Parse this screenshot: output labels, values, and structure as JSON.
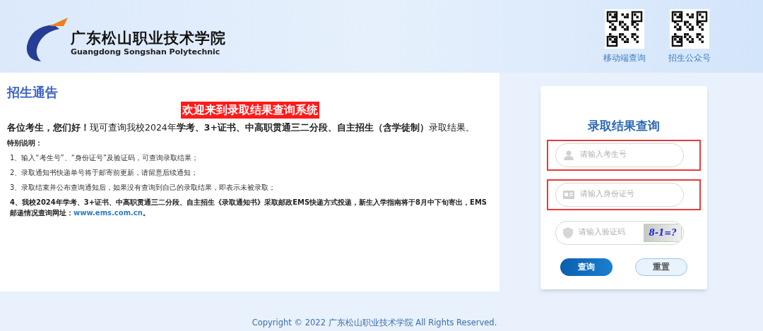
{
  "header": {
    "school_name": "广东松山职业技术学院",
    "school_name_en": "Guangdong Songshan Polytechnic",
    "qr_codes": [
      {
        "label": "移动端查询"
      },
      {
        "label": "招生公众号"
      }
    ]
  },
  "notice": {
    "title": "招生通告",
    "banner": "欢迎来到录取结果查询系统",
    "greeting": "**各位考生，您们好！**现可查询我校2024年**学考、3+证书、中高职贯通三二分段、自主招生（含学徒制）**录取结果。",
    "special_heading": "特别说明：",
    "items": [
      "1、输入“考生号”、“身份证号”及验证码，可查询录取结果；",
      "2、录取通知书快递单号将于邮寄前更新，请留意后续通知；",
      "3、录取结束并公布查询通知后，如果没有查询到自己的录取结果，即表示未被录取；"
    ],
    "final_item": {
      "text": "4、我校2024年学考、3+证书、中高职贯通三二分段、自主招生《录取通知书》采取邮政EMS快递方式投递，新生入学指南将于8月中下旬寄出，EMS邮递情况查询网址：",
      "link": "www.ems.com.cn",
      "end": "。"
    }
  },
  "login": {
    "title": "录取结果查询",
    "fields": [
      {
        "kind": "user",
        "placeholder": "请输入考生号",
        "highlighted": true
      },
      {
        "kind": "id",
        "placeholder": "请输入身份证号",
        "highlighted": true
      },
      {
        "kind": "captcha",
        "placeholder": "请输入验证码",
        "highlighted": false,
        "captcha": "8-1=?"
      }
    ],
    "buttons": [
      {
        "label": "查询",
        "primary": true
      },
      {
        "label": "重置",
        "primary": false
      }
    ]
  },
  "footer": "Copyright © 2022 广东松山职业技术学院 All Rights Reserved."
}
